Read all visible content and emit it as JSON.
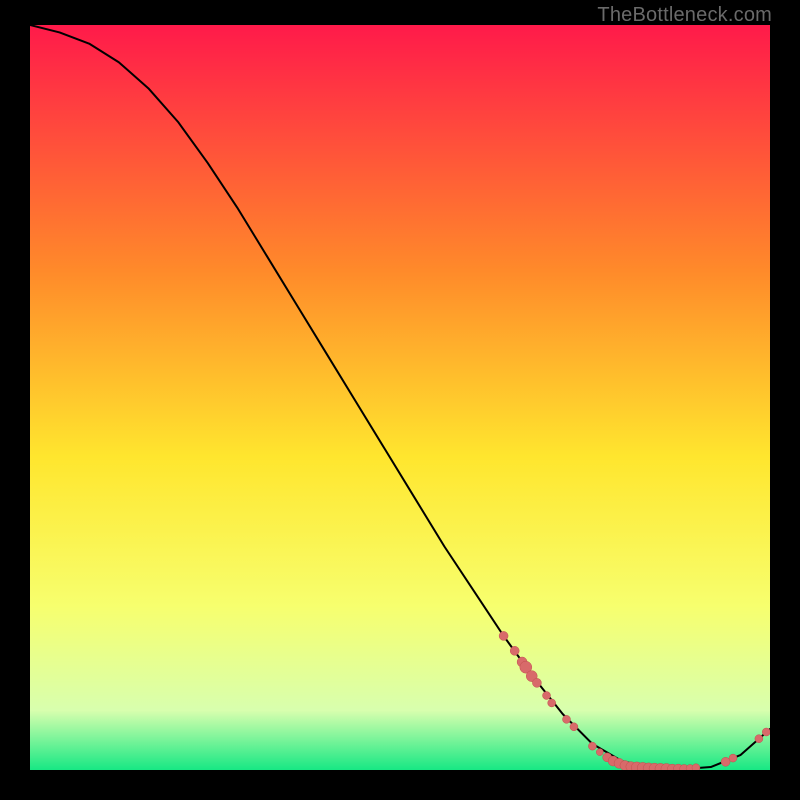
{
  "watermark": "TheBottleneck.com",
  "colors": {
    "gradient_top": "#ff1a4a",
    "gradient_mid1": "#ff8a2a",
    "gradient_mid2": "#ffe62e",
    "gradient_mid3": "#f7ff6e",
    "gradient_bottom_pale": "#d8ffae",
    "gradient_bottom": "#17e884",
    "curve": "#000000",
    "marker_fill": "#d86a6a",
    "marker_stroke": "#c24f4f"
  },
  "chart_data": {
    "type": "line",
    "title": "",
    "xlabel": "",
    "ylabel": "",
    "xlim": [
      0,
      100
    ],
    "ylim": [
      0,
      100
    ],
    "curve": {
      "x": [
        0,
        4,
        8,
        12,
        16,
        20,
        24,
        28,
        32,
        36,
        40,
        44,
        48,
        52,
        56,
        60,
        64,
        68,
        72,
        76,
        80,
        84,
        88,
        92,
        96,
        100
      ],
      "y": [
        100,
        99,
        97.5,
        95,
        91.5,
        87,
        81.5,
        75.5,
        69,
        62.5,
        56,
        49.5,
        43,
        36.5,
        30,
        24,
        18,
        12.5,
        7.5,
        3.5,
        1.2,
        0.3,
        0.1,
        0.4,
        2.0,
        5.5
      ]
    },
    "markers": [
      {
        "x": 64.0,
        "y": 18.0,
        "r": 4.5
      },
      {
        "x": 65.5,
        "y": 16.0,
        "r": 4.5
      },
      {
        "x": 66.5,
        "y": 14.5,
        "r": 5.0
      },
      {
        "x": 67.0,
        "y": 13.8,
        "r": 6.0
      },
      {
        "x": 67.8,
        "y": 12.6,
        "r": 5.5
      },
      {
        "x": 68.5,
        "y": 11.7,
        "r": 4.5
      },
      {
        "x": 69.8,
        "y": 10.0,
        "r": 4.0
      },
      {
        "x": 70.5,
        "y": 9.0,
        "r": 4.0
      },
      {
        "x": 72.5,
        "y": 6.8,
        "r": 4.0
      },
      {
        "x": 73.5,
        "y": 5.8,
        "r": 4.0
      },
      {
        "x": 76.0,
        "y": 3.2,
        "r": 4.0
      },
      {
        "x": 77.0,
        "y": 2.4,
        "r": 3.5
      },
      {
        "x": 78.0,
        "y": 1.7,
        "r": 4.5
      },
      {
        "x": 78.8,
        "y": 1.2,
        "r": 5.0
      },
      {
        "x": 79.6,
        "y": 0.9,
        "r": 5.0
      },
      {
        "x": 80.4,
        "y": 0.6,
        "r": 5.0
      },
      {
        "x": 81.2,
        "y": 0.45,
        "r": 5.0
      },
      {
        "x": 82.0,
        "y": 0.35,
        "r": 5.5
      },
      {
        "x": 82.8,
        "y": 0.28,
        "r": 5.5
      },
      {
        "x": 83.6,
        "y": 0.22,
        "r": 5.5
      },
      {
        "x": 84.4,
        "y": 0.18,
        "r": 5.5
      },
      {
        "x": 85.2,
        "y": 0.15,
        "r": 5.5
      },
      {
        "x": 86.0,
        "y": 0.13,
        "r": 5.5
      },
      {
        "x": 86.8,
        "y": 0.12,
        "r": 5.0
      },
      {
        "x": 87.6,
        "y": 0.12,
        "r": 5.0
      },
      {
        "x": 88.4,
        "y": 0.14,
        "r": 4.5
      },
      {
        "x": 89.2,
        "y": 0.2,
        "r": 4.0
      },
      {
        "x": 90.0,
        "y": 0.3,
        "r": 4.0
      },
      {
        "x": 94.0,
        "y": 1.1,
        "r": 4.5
      },
      {
        "x": 95.0,
        "y": 1.6,
        "r": 4.0
      },
      {
        "x": 98.5,
        "y": 4.2,
        "r": 4.0
      },
      {
        "x": 99.5,
        "y": 5.1,
        "r": 4.0
      }
    ]
  }
}
